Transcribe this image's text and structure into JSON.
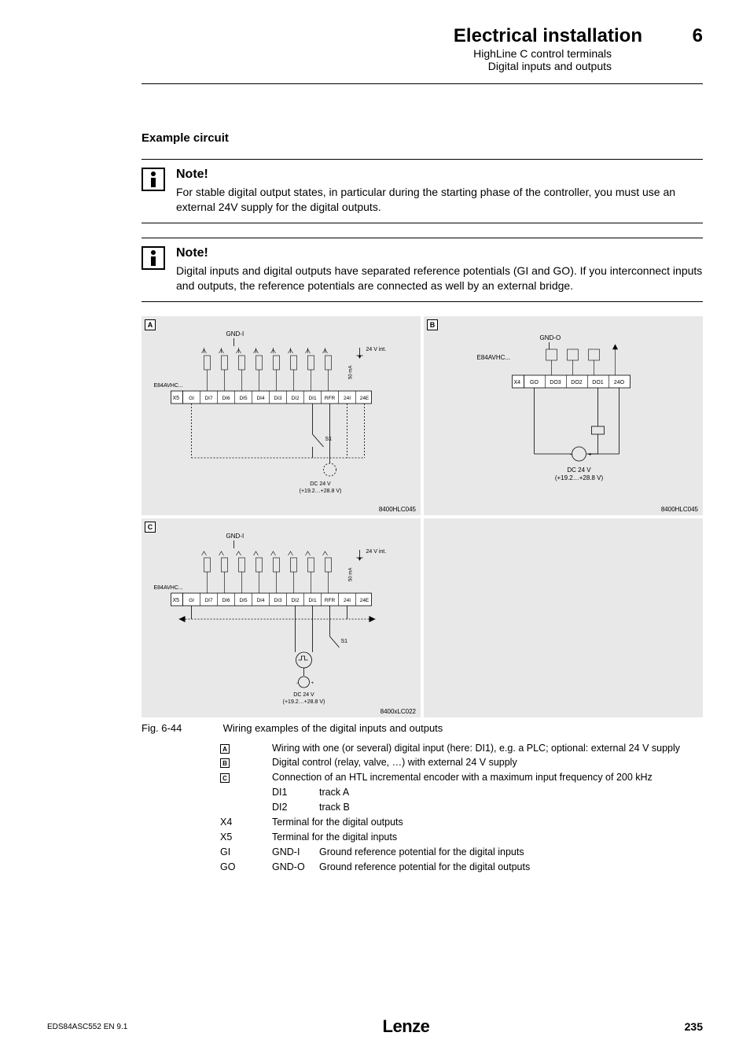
{
  "header": {
    "title": "Electrical installation",
    "chapter": "6",
    "sub1": "HighLine C control terminals",
    "sub2": "Digital inputs and outputs"
  },
  "exampleHeading": "Example circuit",
  "notes": [
    {
      "title": "Note!",
      "text": "For stable digital output states, in particular during the starting phase of the controller, you must use an external 24V supply for the digital outputs."
    },
    {
      "title": "Note!",
      "text": "Digital inputs and digital outputs have separated reference potentials (GI and GO). If you interconnect inputs and outputs, the reference potentials are connected as well by an external bridge."
    }
  ],
  "diagrams": {
    "A": {
      "label": "A",
      "device": "E84AVHC...",
      "conn": "X5",
      "gnd": "GND-I",
      "vint": "24 V int.",
      "curr": "50 mA",
      "terms": [
        "GI",
        "DI7",
        "DI6",
        "DI5",
        "DI4",
        "DI3",
        "DI2",
        "DI1",
        "RFR",
        "24I",
        "24E"
      ],
      "switch": "S1",
      "supply1": "DC 24 V",
      "supply2": "(+19.2…+28.8 V)",
      "code": "8400HLC045"
    },
    "B": {
      "label": "B",
      "device": "E84AVHC...",
      "conn": "X4",
      "gnd": "GND-O",
      "terms": [
        "GO",
        "DO3",
        "DO2",
        "DO1",
        "24O"
      ],
      "supply1": "DC 24 V",
      "supply2": "(+19.2…+28.8 V)",
      "code": "8400HLC045"
    },
    "C": {
      "label": "C",
      "device": "E84AVHC...",
      "conn": "X5",
      "gnd": "GND-I",
      "vint": "24 V int.",
      "curr": "50 mA",
      "terms": [
        "GI",
        "DI7",
        "DI6",
        "DI5",
        "DI4",
        "DI3",
        "DI2",
        "DI1",
        "RFR",
        "24I",
        "24E"
      ],
      "switch": "S1",
      "supply1": "DC 24 V",
      "supply2": "(+19.2…+28.8 V)",
      "code": "8400xLC022"
    }
  },
  "figure": {
    "num": "Fig. 6-44",
    "caption": "Wiring examples of the digital inputs and outputs"
  },
  "legend": {
    "A": "Wiring with one (or several) digital input (here: DI1), e.g. a PLC; optional: external 24 V supply",
    "B": "Digital control (relay, valve, …) with external 24 V supply",
    "C": "Connection of an HTL incremental encoder with a maximum input frequency of 200 kHz",
    "C_DI1_k": "DI1",
    "C_DI1_v": "track A",
    "C_DI2_k": "DI2",
    "C_DI2_v": "track B",
    "X4_k": "X4",
    "X4_v": "Terminal for the digital outputs",
    "X5_k": "X5",
    "X5_v": "Terminal for the digital inputs",
    "GI_k": "GI",
    "GI_s": "GND-I",
    "GI_v": "Ground reference potential for the digital inputs",
    "GO_k": "GO",
    "GO_s": "GND-O",
    "GO_v": "Ground reference potential for the digital outputs"
  },
  "footer": {
    "docid": "EDS84ASC552  EN  9.1",
    "logo": "Lenze",
    "page": "235"
  }
}
